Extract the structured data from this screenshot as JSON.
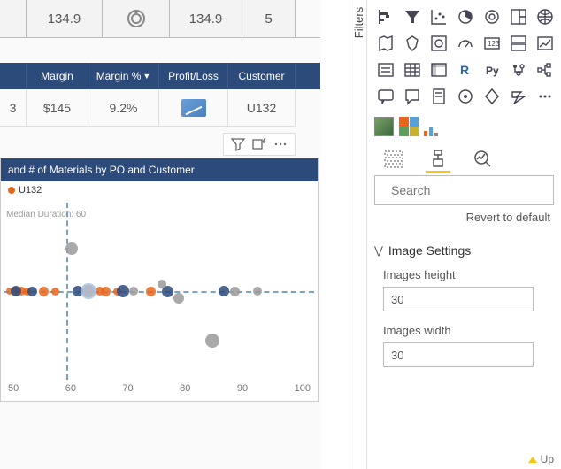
{
  "kpi_row": {
    "v1": "134.9",
    "v2": "134.9",
    "v3": "5"
  },
  "matrix": {
    "headers": {
      "margin": "Margin",
      "margin_pct": "Margin %",
      "pl": "Profit/Loss",
      "customer": "Customer"
    },
    "row": {
      "margin": "$145",
      "margin_pct": "9.2%",
      "customer": "U132"
    }
  },
  "scatter": {
    "title": "and # of Materials by PO and Customer",
    "legend_label": "U132",
    "ref_label": "Median Duration: 60",
    "axis_ticks": [
      "50",
      "60",
      "70",
      "80",
      "90",
      "100"
    ]
  },
  "filters_label": "Filters",
  "search": {
    "placeholder": "Search"
  },
  "revert": "Revert to default",
  "section": {
    "title": "Image Settings",
    "height_label": "Images height",
    "height_value": "30",
    "width_label": "Images width",
    "width_value": "30"
  },
  "footer_up": "Up",
  "chart_data": {
    "type": "scatter",
    "title": "and # of Materials by PO and Customer",
    "xlabel": "",
    "ylabel": "",
    "xlim": [
      45,
      100
    ],
    "ref_lines": {
      "x": 60,
      "y_label": "median"
    },
    "legend": [
      "U132"
    ],
    "series": [
      {
        "name": "U132",
        "color": "#e8671c",
        "points": [
          {
            "x": 46,
            "y": 0,
            "size": 8
          },
          {
            "x": 47,
            "y": 0,
            "size": 10
          },
          {
            "x": 48,
            "y": 0,
            "size": 10
          },
          {
            "x": 49,
            "y": 0,
            "size": 9
          },
          {
            "x": 52,
            "y": 0,
            "size": 11
          },
          {
            "x": 54,
            "y": 0,
            "size": 9
          },
          {
            "x": 60,
            "y": 0,
            "size": 14
          },
          {
            "x": 62,
            "y": 0,
            "size": 10
          },
          {
            "x": 63,
            "y": 0,
            "size": 11
          },
          {
            "x": 65,
            "y": 0,
            "size": 9
          },
          {
            "x": 71,
            "y": 0,
            "size": 11
          }
        ]
      },
      {
        "name": "navy",
        "color": "#2c4a7a",
        "points": [
          {
            "x": 47,
            "y": 0,
            "size": 12
          },
          {
            "x": 50,
            "y": 0,
            "size": 11
          },
          {
            "x": 58,
            "y": 0,
            "size": 12
          },
          {
            "x": 66,
            "y": 0,
            "size": 14
          },
          {
            "x": 74,
            "y": 0,
            "size": 13
          },
          {
            "x": 84,
            "y": 0,
            "size": 12
          }
        ]
      },
      {
        "name": "grey",
        "color": "#9a9a9a",
        "points": [
          {
            "x": 57,
            "y": 6,
            "size": 14
          },
          {
            "x": 68,
            "y": 0,
            "size": 10
          },
          {
            "x": 73,
            "y": 1,
            "size": 10
          },
          {
            "x": 76,
            "y": -1,
            "size": 12
          },
          {
            "x": 82,
            "y": -7,
            "size": 16
          },
          {
            "x": 86,
            "y": 0,
            "size": 11
          },
          {
            "x": 90,
            "y": 0,
            "size": 10
          }
        ]
      },
      {
        "name": "light",
        "color": "#a8c3e0",
        "points": [
          {
            "x": 60,
            "y": 0,
            "size": 18
          }
        ]
      }
    ]
  }
}
